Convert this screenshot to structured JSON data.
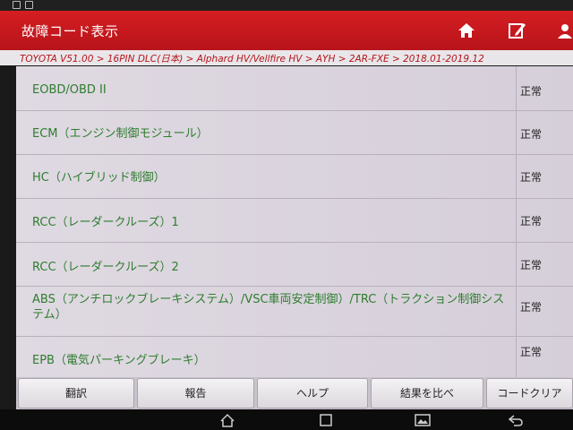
{
  "app": {
    "title": "故障コード表示"
  },
  "breadcrumb": "TOYOTA V51.00 > 16PIN DLC(日本) > Alphard HV/Vellfire HV > AYH > 2AR-FXE > 2018.01-2019.12",
  "systems": [
    {
      "name": "EOBD/OBD II",
      "status": "正常"
    },
    {
      "name": "ECM（エンジン制御モジュール）",
      "status": "正常"
    },
    {
      "name": "HC（ハイブリッド制御）",
      "status": "正常"
    },
    {
      "name": "RCC（レーダークルーズ）1",
      "status": "正常"
    },
    {
      "name": "RCC（レーダークルーズ）2",
      "status": "正常"
    },
    {
      "name": "ABS（アンチロックブレーキシステム）/VSC車両安定制御）/TRC（トラクション制御システム）",
      "status": "正常"
    },
    {
      "name": "EPB（電気パーキングブレーキ）",
      "status": "正常"
    }
  ],
  "buttons": {
    "translate": "翻訳",
    "report": "報告",
    "help": "ヘルプ",
    "compare": "結果を比べ",
    "clear_codes": "コードクリア"
  },
  "icons": {
    "home": "home-icon",
    "edit": "edit-icon",
    "user": "user-icon",
    "back": "back-icon",
    "recents": "recents-icon",
    "screenshot": "screenshot-icon"
  },
  "colors": {
    "header": "#c8181e",
    "breadcrumb_text": "#b4141a",
    "system_text": "#2e7d2e",
    "list_bg": "#d7d0db"
  }
}
